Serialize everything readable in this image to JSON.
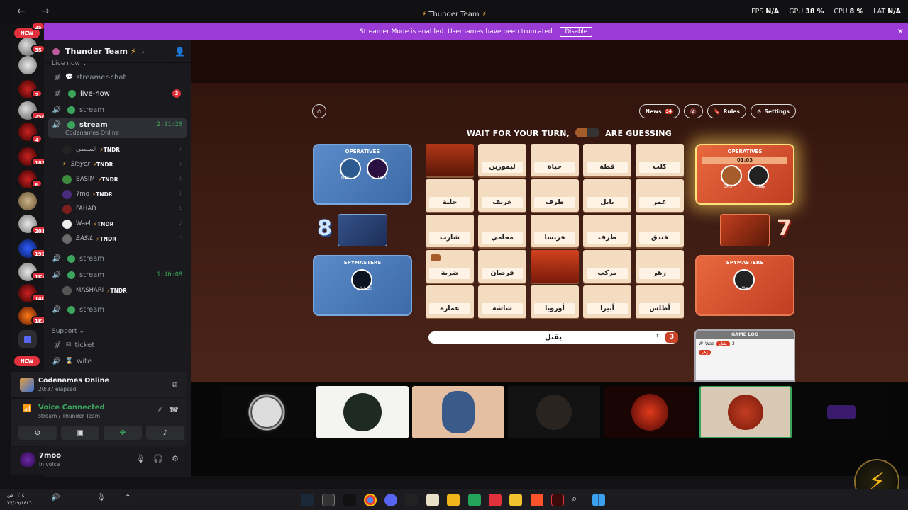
{
  "window": {
    "title": "Thunder Team",
    "back_label": "←",
    "forward_label": "→",
    "stats": [
      {
        "k": "FPS",
        "v": "N/A"
      },
      {
        "k": "GPU",
        "v": "38 %"
      },
      {
        "k": "CPU",
        "v": "8 %"
      },
      {
        "k": "LAT",
        "v": "N/A"
      }
    ]
  },
  "banner": {
    "text": "Streamer Mode is enabled. Usernames have been truncated.",
    "button": "Disable",
    "close": "✕"
  },
  "rail": {
    "new_top": "NEW",
    "new_bottom": "NEW",
    "badges": [
      "25",
      "35",
      "2",
      "256",
      "4",
      "183",
      "6",
      "201",
      "192",
      "1K+",
      "140",
      "1K+"
    ]
  },
  "server": {
    "name": "Thunder Team",
    "categories": {
      "live": "Live now",
      "support": "Support"
    },
    "channels": {
      "streamer_chat": "streamer-chat",
      "live_now": "live-now",
      "live_now_badge": "3",
      "stream1": "stream",
      "stream_active": "stream",
      "stream_active_sub": "Codenames Online",
      "stream_active_timer": "2:11:20",
      "stream3": "stream",
      "stream4": "stream",
      "stream4_timer": "1:46:08",
      "stream5": "stream",
      "ticket": "ticket",
      "wite": "wite"
    },
    "users_active": [
      {
        "name": "السلطي",
        "tag": "TNDR"
      },
      {
        "name": "Slayer",
        "tag": "TNDR"
      },
      {
        "name": "BASIM",
        "tag": "TNDR"
      },
      {
        "name": "7mo",
        "tag": "TNDR"
      },
      {
        "name": "FAHAD",
        "tag": ""
      },
      {
        "name": "Wael",
        "tag": "TNDR"
      },
      {
        "name": "BASIL",
        "tag": "TNDR"
      }
    ],
    "users_stream4": [
      {
        "name": "MASHARI",
        "tag": "TNDR"
      }
    ]
  },
  "activity": {
    "title": "Codenames Online",
    "elapsed": "20:37 elapsed"
  },
  "voice": {
    "status": "Voice Connected",
    "location": "stream / Thunder Team"
  },
  "me": {
    "name": "7moo",
    "status": "In voice"
  },
  "game": {
    "top_buttons": {
      "news": "News",
      "news_count": "34",
      "rules": "Rules",
      "settings": "Settings"
    },
    "status_line_a": "WAIT FOR YOUR TURN,",
    "status_line_b": "ARE GUESSING",
    "blue_operatives_label": "OPERATIVES",
    "blue_spymasters_label": "SPYMASTERS",
    "red_operatives_label": "OPERATIVES",
    "red_spymasters_label": "SPYMASTERS",
    "red_timer": "01:03",
    "blue_players": [
      "BAS",
      "7mo"
    ],
    "blue_spymaster": "السلطي",
    "red_players": [
      "BAS",
      "Slay"
    ],
    "red_spymaster": "Wae",
    "blue_score": "8",
    "red_score": "7",
    "board": [
      [
        "",
        "ليموزين",
        "حياة",
        "قطة",
        "كلب"
      ],
      [
        "حلبة",
        "خريف",
        "طرف",
        "بابل",
        "عمر"
      ],
      [
        "شارب",
        "محامي",
        "فرنسا",
        "طرف",
        "فندق"
      ],
      [
        "ضربة",
        "قرصان",
        "",
        "مركب",
        "زهر"
      ],
      [
        "عمارة",
        "شاشة",
        "أوروبا",
        "أبيرا",
        "أطلس"
      ]
    ],
    "clue_word": "يقتل",
    "clue_number": "3",
    "game_log_label": "GAME LOG",
    "log_entries": [
      {
        "player": "Wae",
        "word": "يقتل",
        "num": "3"
      },
      {
        "player": "",
        "word": "زهر",
        "num": ""
      }
    ]
  },
  "taskbar": {
    "time": "٠٢:٤٠ ص",
    "date": "٢٧/٠٩/١٤٤٦"
  }
}
